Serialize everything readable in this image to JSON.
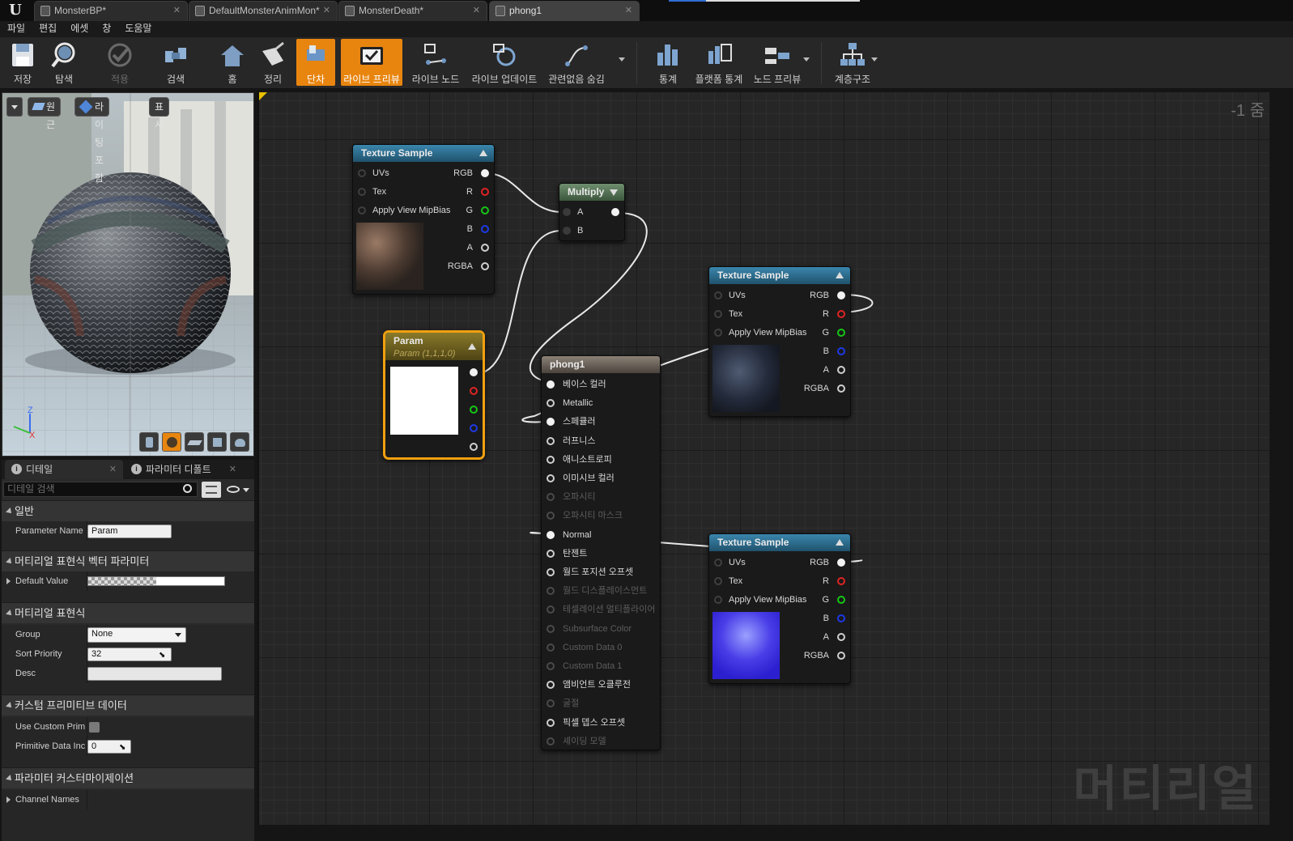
{
  "tabs": [
    {
      "label": "MonsterBP*",
      "active": false
    },
    {
      "label": "DefaultMonsterAnimMon*",
      "active": false
    },
    {
      "label": "MonsterDeath*",
      "active": false
    },
    {
      "label": "phong1",
      "active": true
    }
  ],
  "menu": [
    "파일",
    "편집",
    "에셋",
    "창",
    "도움말"
  ],
  "toolbar": [
    {
      "label": "저장",
      "icon": "save-icon",
      "state": "normal"
    },
    {
      "label": "탐색",
      "icon": "browse-icon",
      "state": "normal"
    },
    {
      "label": "적용",
      "icon": "apply-icon",
      "state": "disabled"
    },
    {
      "label": "검색",
      "icon": "search-icon",
      "state": "normal"
    },
    {
      "label": "홈",
      "icon": "home-icon",
      "state": "normal"
    },
    {
      "label": "정리",
      "icon": "clean-icon",
      "state": "normal"
    },
    {
      "label": "단차",
      "icon": "stats-icon",
      "state": "active"
    },
    {
      "label": "라이브 프리뷰",
      "icon": "live-preview-icon",
      "state": "active"
    },
    {
      "label": "라이브 노드",
      "icon": "live-nodes-icon",
      "state": "normal"
    },
    {
      "label": "라이브 업데이트",
      "icon": "live-update-icon",
      "state": "normal"
    },
    {
      "label": "관련없음 숨김",
      "icon": "hide-unrelated-icon",
      "state": "normal"
    },
    {
      "label": "통계",
      "icon": "stats-bars-icon",
      "state": "normal"
    },
    {
      "label": "플랫폼 통계",
      "icon": "platform-stats-icon",
      "state": "normal"
    },
    {
      "label": "노드 프리뷰",
      "icon": "node-preview-icon",
      "state": "normal"
    },
    {
      "label": "계층구조",
      "icon": "hierarchy-icon",
      "state": "normal"
    }
  ],
  "viewport": {
    "toolbar": [
      "원근",
      "라이팅포함",
      "표시"
    ],
    "axis": {
      "z": "Z",
      "x": "X"
    }
  },
  "details": {
    "tabs": [
      "디테일",
      "파라미터 디폴트"
    ],
    "search_placeholder": "디테일 검색",
    "sections": {
      "general": "일반",
      "vector_param": "머티리얼 표현식 벡터 파라미터",
      "expression": "머티리얼 표현식",
      "custom_prim": "커스텀 프리미티브 데이터",
      "param_custom": "파라미터 커스터마이제이션"
    },
    "props": {
      "param_name_label": "Parameter Name",
      "param_name_value": "Param",
      "default_value_label": "Default Value",
      "group_label": "Group",
      "group_value": "None",
      "sort_priority_label": "Sort Priority",
      "sort_priority_value": "32",
      "desc_label": "Desc",
      "use_custom_prim_label": "Use Custom Prim",
      "primitive_data_label": "Primitive Data Inc",
      "primitive_data_value": "0",
      "channel_names_label": "Channel Names"
    }
  },
  "graph": {
    "zoom": "-1 줌",
    "watermark": "머티리얼",
    "texture_sample_title": "Texture Sample",
    "texture_inputs": [
      "UVs",
      "Tex",
      "Apply View MipBias"
    ],
    "texture_outputs": [
      "RGB",
      "R",
      "G",
      "B",
      "A",
      "RGBA"
    ],
    "multiply": {
      "title": "Multiply",
      "inputs": [
        "A",
        "B"
      ]
    },
    "param": {
      "title": "Param",
      "subtitle": "Param (1,1,1,0)"
    },
    "phong": {
      "title": "phong1",
      "inputs": [
        {
          "label": "베이스 컬러",
          "state": "connected"
        },
        {
          "label": "Metallic",
          "state": "enabled"
        },
        {
          "label": "스페큘러",
          "state": "connected"
        },
        {
          "label": "러프니스",
          "state": "enabled"
        },
        {
          "label": "애니소트로피",
          "state": "enabled"
        },
        {
          "label": "이미시브 컬러",
          "state": "enabled"
        },
        {
          "label": "오파시티",
          "state": "disabled"
        },
        {
          "label": "오파시티 마스크",
          "state": "disabled"
        },
        {
          "label": "Normal",
          "state": "connected"
        },
        {
          "label": "탄젠트",
          "state": "enabled"
        },
        {
          "label": "월드 포지션 오프셋",
          "state": "enabled"
        },
        {
          "label": "월드 디스플레이스먼트",
          "state": "disabled"
        },
        {
          "label": "테셀레이션 멀티플라이어",
          "state": "disabled"
        },
        {
          "label": "Subsurface Color",
          "state": "disabled"
        },
        {
          "label": "Custom Data 0",
          "state": "disabled"
        },
        {
          "label": "Custom Data 1",
          "state": "disabled"
        },
        {
          "label": "앰비언트 오클루전",
          "state": "enabled"
        },
        {
          "label": "굴절",
          "state": "disabled"
        },
        {
          "label": "픽셀 뎁스 오프셋",
          "state": "enabled"
        },
        {
          "label": "셰이딩 모델",
          "state": "disabled"
        }
      ]
    }
  },
  "colors": {
    "accent": "#e8850f",
    "texture_header": "#2b6a88",
    "multiply_header": "#4d6e4d",
    "param_header": "#6b5a1f",
    "result_header": "#6a6158",
    "pin_red": "#e02323",
    "pin_green": "#16c716",
    "pin_blue": "#1d39e6"
  }
}
